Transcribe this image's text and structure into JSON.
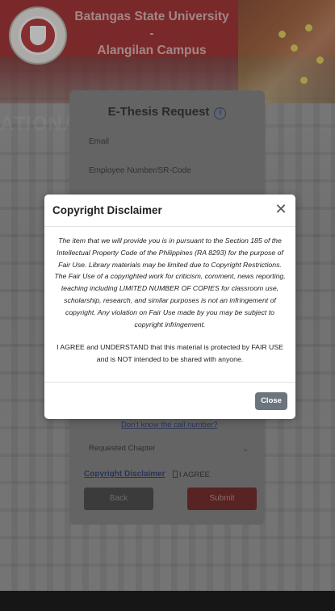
{
  "header": {
    "title_line1": "Batangas State University -",
    "title_line2": "Alangilan Campus"
  },
  "form": {
    "title": "E-Thesis Request",
    "email_placeholder": "Email",
    "employee_placeholder": "Employee Number/SR-Code",
    "call_number_link": "Don't know the call number?",
    "requested_chapter": "Requested Chapter",
    "copyright_link": "Copyright Disclaimer",
    "agree_label": "I AGREE",
    "back_label": "Back",
    "submit_label": "Submit"
  },
  "modal": {
    "title": "Copyright Disclaimer",
    "close_icon": "close-icon",
    "paragraph1": "The item that we will provide you is in pursuant to the Section 185 of the Intellectual Property Code of the Philippines (RA 8293) for the purpose of Fair Use. Library materials may be limited due to Copyright Restrictions. The Fair Use of a copyrighted work for criticism, comment, news reporting, teaching including LIMITED NUMBER OF COPIES for classroom use, scholarship, research, and similar purposes is not an infringement of copyright. Any violation on Fair Use made by you may be subject to copyright infringement.",
    "paragraph2": "I AGREE and UNDERSTAND that this material is protected by FAIR USE and is NOT intended to be shared with anyone.",
    "close_button": "Close"
  },
  "colors": {
    "brand_red": "#9e1d1d",
    "close_button": "#6c757d",
    "link_blue": "#1c2f6f"
  }
}
